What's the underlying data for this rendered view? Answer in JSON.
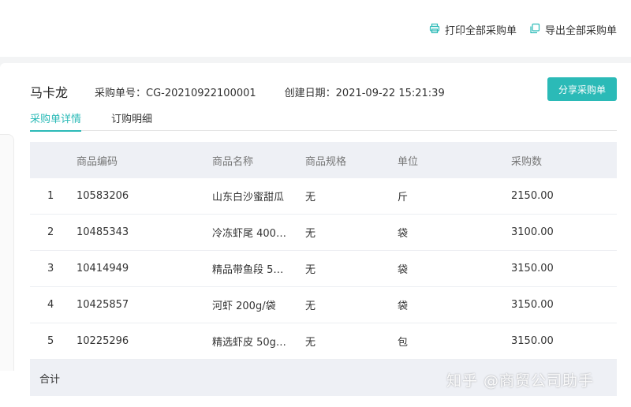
{
  "toolbar": {
    "print_all_label": "打印全部采购单",
    "export_all_label": "导出全部采购单"
  },
  "order": {
    "supplier": "马卡龙",
    "order_no": "采购单号：CG-20210922100001",
    "created": "创建日期：2021-09-22 15:21:39",
    "share_label": "分享采购单"
  },
  "tabs": [
    {
      "label": "采购单详情",
      "active": true
    },
    {
      "label": "订购明细",
      "active": false
    }
  ],
  "table": {
    "headers": [
      "",
      "商品编码",
      "商品名称",
      "商品规格",
      "单位",
      "采购数"
    ],
    "rows": [
      [
        "1",
        "10583206",
        "山东白沙蜜甜瓜",
        "无",
        "斤",
        "2150.00"
      ],
      [
        "2",
        "10485343",
        "冷冻虾尾 400…",
        "无",
        "袋",
        "3100.00"
      ],
      [
        "3",
        "10414949",
        "精品带鱼段 5…",
        "无",
        "袋",
        "3150.00"
      ],
      [
        "4",
        "10425857",
        "河虾 200g/袋",
        "无",
        "袋",
        "3150.00"
      ],
      [
        "5",
        "10225296",
        "精选虾皮 50g…",
        "无",
        "包",
        "3150.00"
      ]
    ],
    "footer_label": "合计"
  },
  "watermark": "知乎 @商贸公司助手",
  "colors": {
    "accent": "#2bbab7",
    "header_bg": "#eef0f5"
  },
  "icons": {
    "print": "printer-icon",
    "export": "copy-icon"
  }
}
